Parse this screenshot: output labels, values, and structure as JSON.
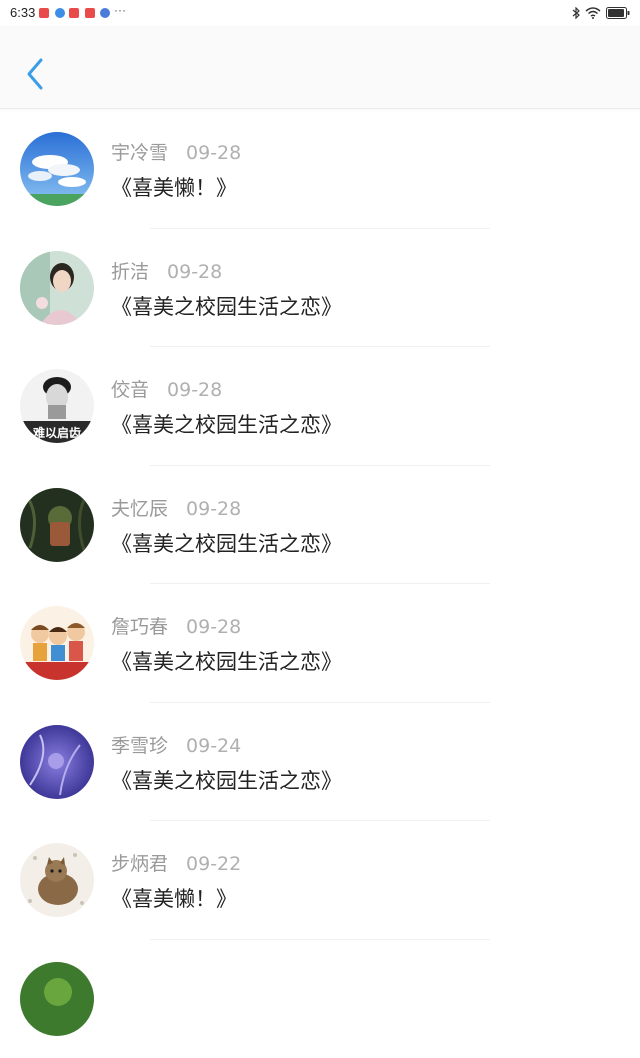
{
  "status": {
    "time": "6:33",
    "more": "···",
    "notif_colors": [
      "#e94b4b",
      "#3d8ee6",
      "#e94b4b",
      "#e94b4b",
      "#4a7bd8"
    ]
  },
  "header": {
    "back_icon": "chevron-left-icon",
    "accent": "#3a9de8"
  },
  "comments": [
    {
      "name": "宇冷雪",
      "date": "09-28",
      "book": "《喜美懒！》",
      "avatar": "sky-clouds"
    },
    {
      "name": "折洁",
      "date": "09-28",
      "book": "《喜美之校园生活之恋》",
      "avatar": "woman-portrait"
    },
    {
      "name": "佼音",
      "date": "09-28",
      "book": "《喜美之校园生活之恋》",
      "avatar": "bw-portrait"
    },
    {
      "name": "夫忆辰",
      "date": "09-28",
      "book": "《喜美之校园生活之恋》",
      "avatar": "dark-photo"
    },
    {
      "name": "詹巧春",
      "date": "09-28",
      "book": "《喜美之校园生活之恋》",
      "avatar": "cartoon-kids"
    },
    {
      "name": "季雪珍",
      "date": "09-24",
      "book": "《喜美之校园生活之恋》",
      "avatar": "purple-abstract"
    },
    {
      "name": "步炳君",
      "date": "09-22",
      "book": "《喜美懒！》",
      "avatar": "cat-photo"
    },
    {
      "name": "",
      "date": "",
      "book": "",
      "avatar": "green-photo"
    }
  ],
  "avatar_text": {
    "bw-portrait": "难以启齿"
  }
}
